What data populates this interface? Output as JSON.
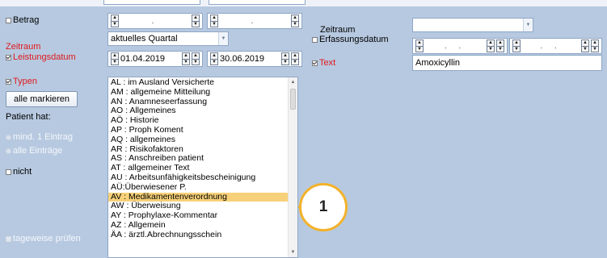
{
  "filters": {
    "betrag": {
      "label": "Betrag"
    },
    "zeitraum_leistungsdatum": {
      "label_line1": "Zeitraum",
      "label_line2": "Leistungsdatum",
      "quarter": "aktuelles Quartal",
      "from": "01.04.2019",
      "to": "30.06.2019"
    },
    "zeitraum_erfassungsdatum": {
      "label_line1": "Zeitraum",
      "label_line2": "Erfassungsdatum",
      "combo_value": ""
    },
    "text": {
      "label": "Text",
      "value": "Amoxicyllin"
    },
    "typen": {
      "label": "Typen",
      "select_all_button": "alle markieren",
      "items": [
        "AL : im Ausland Versicherte",
        "AM : allgemeine Mitteilung",
        "AN : Anamneseerfassung",
        "AO : Allgemeines",
        "AÖ : Historie",
        "AP : Proph Koment",
        "AQ : allgemeines",
        "AR : Risikofaktoren",
        "AS : Anschreiben patient",
        "AT : allgemeiner Text",
        "AU : Arbeitsunfähigkeitsbescheinigung",
        "AÜ:Überwiesener P.",
        "AV : Medikamentenverordnung",
        "AW : Überweisung",
        "AY : Prophylaxe-Kommentar",
        "AZ : Allgemein",
        "ÄA : ärztl.Abrechnungsschein"
      ],
      "selected_index": 12
    },
    "patient_hat": {
      "label": "Patient hat:",
      "option_min": "mind. 1 Eintrag",
      "option_all": "alle Einträge"
    },
    "nicht": {
      "label": "nicht"
    },
    "tageweise": {
      "label": "tageweise prüfen"
    }
  },
  "callout": {
    "number": "1"
  },
  "colors": {
    "background": "#b7c9e0",
    "highlight": "#f7d179",
    "callout": "#f3b22a",
    "red_label": "#e0191e"
  }
}
